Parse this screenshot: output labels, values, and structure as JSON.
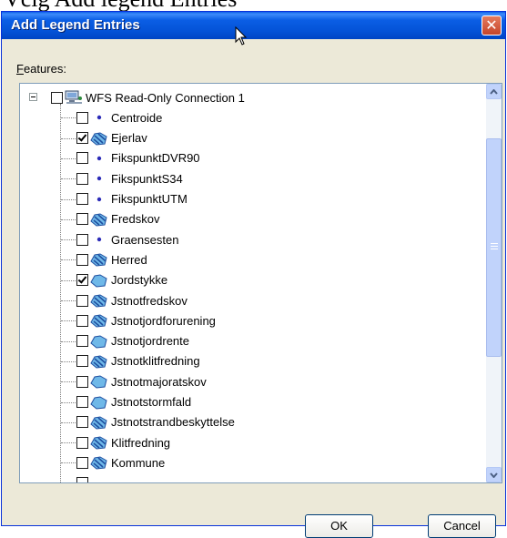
{
  "background_caption": "Vcig Add legend Entries",
  "dialog": {
    "title": "Add Legend Entries",
    "close_glyph": "✕",
    "features_label_first": "F",
    "features_label_rest": "eatures:",
    "ok_label": "OK",
    "cancel_label": "Cancel"
  },
  "tree": {
    "root": {
      "label": "WFS Read-Only Connection 1",
      "checked": false,
      "icon": "server-icon"
    },
    "items": [
      {
        "label": "Centroide",
        "checked": false,
        "icon": "point-icon"
      },
      {
        "label": "Ejerlav",
        "checked": true,
        "icon": "polygon-hatched-icon"
      },
      {
        "label": "FikspunktDVR90",
        "checked": false,
        "icon": "point-icon"
      },
      {
        "label": "FikspunktS34",
        "checked": false,
        "icon": "point-icon"
      },
      {
        "label": "FikspunktUTM",
        "checked": false,
        "icon": "point-icon"
      },
      {
        "label": "Fredskov",
        "checked": false,
        "icon": "polygon-hatched-icon"
      },
      {
        "label": "Graensesten",
        "checked": false,
        "icon": "point-icon"
      },
      {
        "label": "Herred",
        "checked": false,
        "icon": "polygon-hatched-icon"
      },
      {
        "label": "Jordstykke",
        "checked": true,
        "icon": "polygon-icon"
      },
      {
        "label": "Jstnotfredskov",
        "checked": false,
        "icon": "polygon-hatched-icon"
      },
      {
        "label": "Jstnotjordforurening",
        "checked": false,
        "icon": "polygon-hatched-icon"
      },
      {
        "label": "Jstnotjordrente",
        "checked": false,
        "icon": "polygon-icon"
      },
      {
        "label": "Jstnotklitfredning",
        "checked": false,
        "icon": "polygon-hatched-icon"
      },
      {
        "label": "Jstnotmajoratskov",
        "checked": false,
        "icon": "polygon-icon"
      },
      {
        "label": "Jstnotstormfald",
        "checked": false,
        "icon": "polygon-icon"
      },
      {
        "label": "Jstnotstrandbeskyttelse",
        "checked": false,
        "icon": "polygon-hatched-icon"
      },
      {
        "label": "Klitfredning",
        "checked": false,
        "icon": "polygon-hatched-icon"
      },
      {
        "label": "Kommune",
        "checked": false,
        "icon": "polygon-hatched-icon"
      }
    ]
  },
  "colors": {
    "point": "#2B2BB8",
    "polygon_fill": "#6FB8E8",
    "polygon_stroke": "#1F4FA0"
  }
}
